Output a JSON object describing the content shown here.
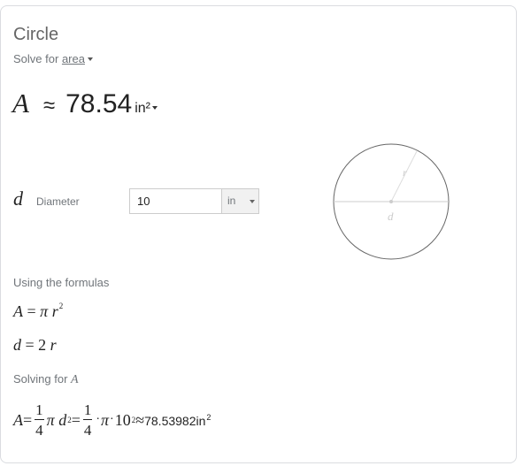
{
  "card": {
    "title": "Circle",
    "solve_for_prefix": "Solve for",
    "solve_for_value": "area"
  },
  "result": {
    "variable": "A",
    "approx": "≈",
    "value": "78.54",
    "unit": "in²"
  },
  "input": {
    "variable": "d",
    "label": "Diameter",
    "value": "10",
    "unit": "in"
  },
  "diagram": {
    "radius_label": "r",
    "diameter_label": "d"
  },
  "formulas": {
    "label": "Using the formulas",
    "eq1": {
      "lhs": "A",
      "eq": " = ",
      "pi": "π",
      "r": "r",
      "exp": "2"
    },
    "eq2": {
      "lhs": "d",
      "eq": " = 2",
      "r": "r"
    }
  },
  "solving": {
    "label_prefix": "Solving for",
    "variable": "A"
  },
  "final": {
    "lhs": "A",
    "eq1": " = ",
    "frac_num": "1",
    "frac_den": "4",
    "pi": "π",
    "d": "d",
    "exp": "2",
    "eq2": " = ",
    "frac2_num": "1",
    "frac2_den": "4",
    "dot": "·",
    "pi2": "π",
    "dot2": "·",
    "ten": "10",
    "exp2": "2",
    "approx": " ≈ ",
    "result": "78.53982in",
    "result_exp": "2"
  }
}
